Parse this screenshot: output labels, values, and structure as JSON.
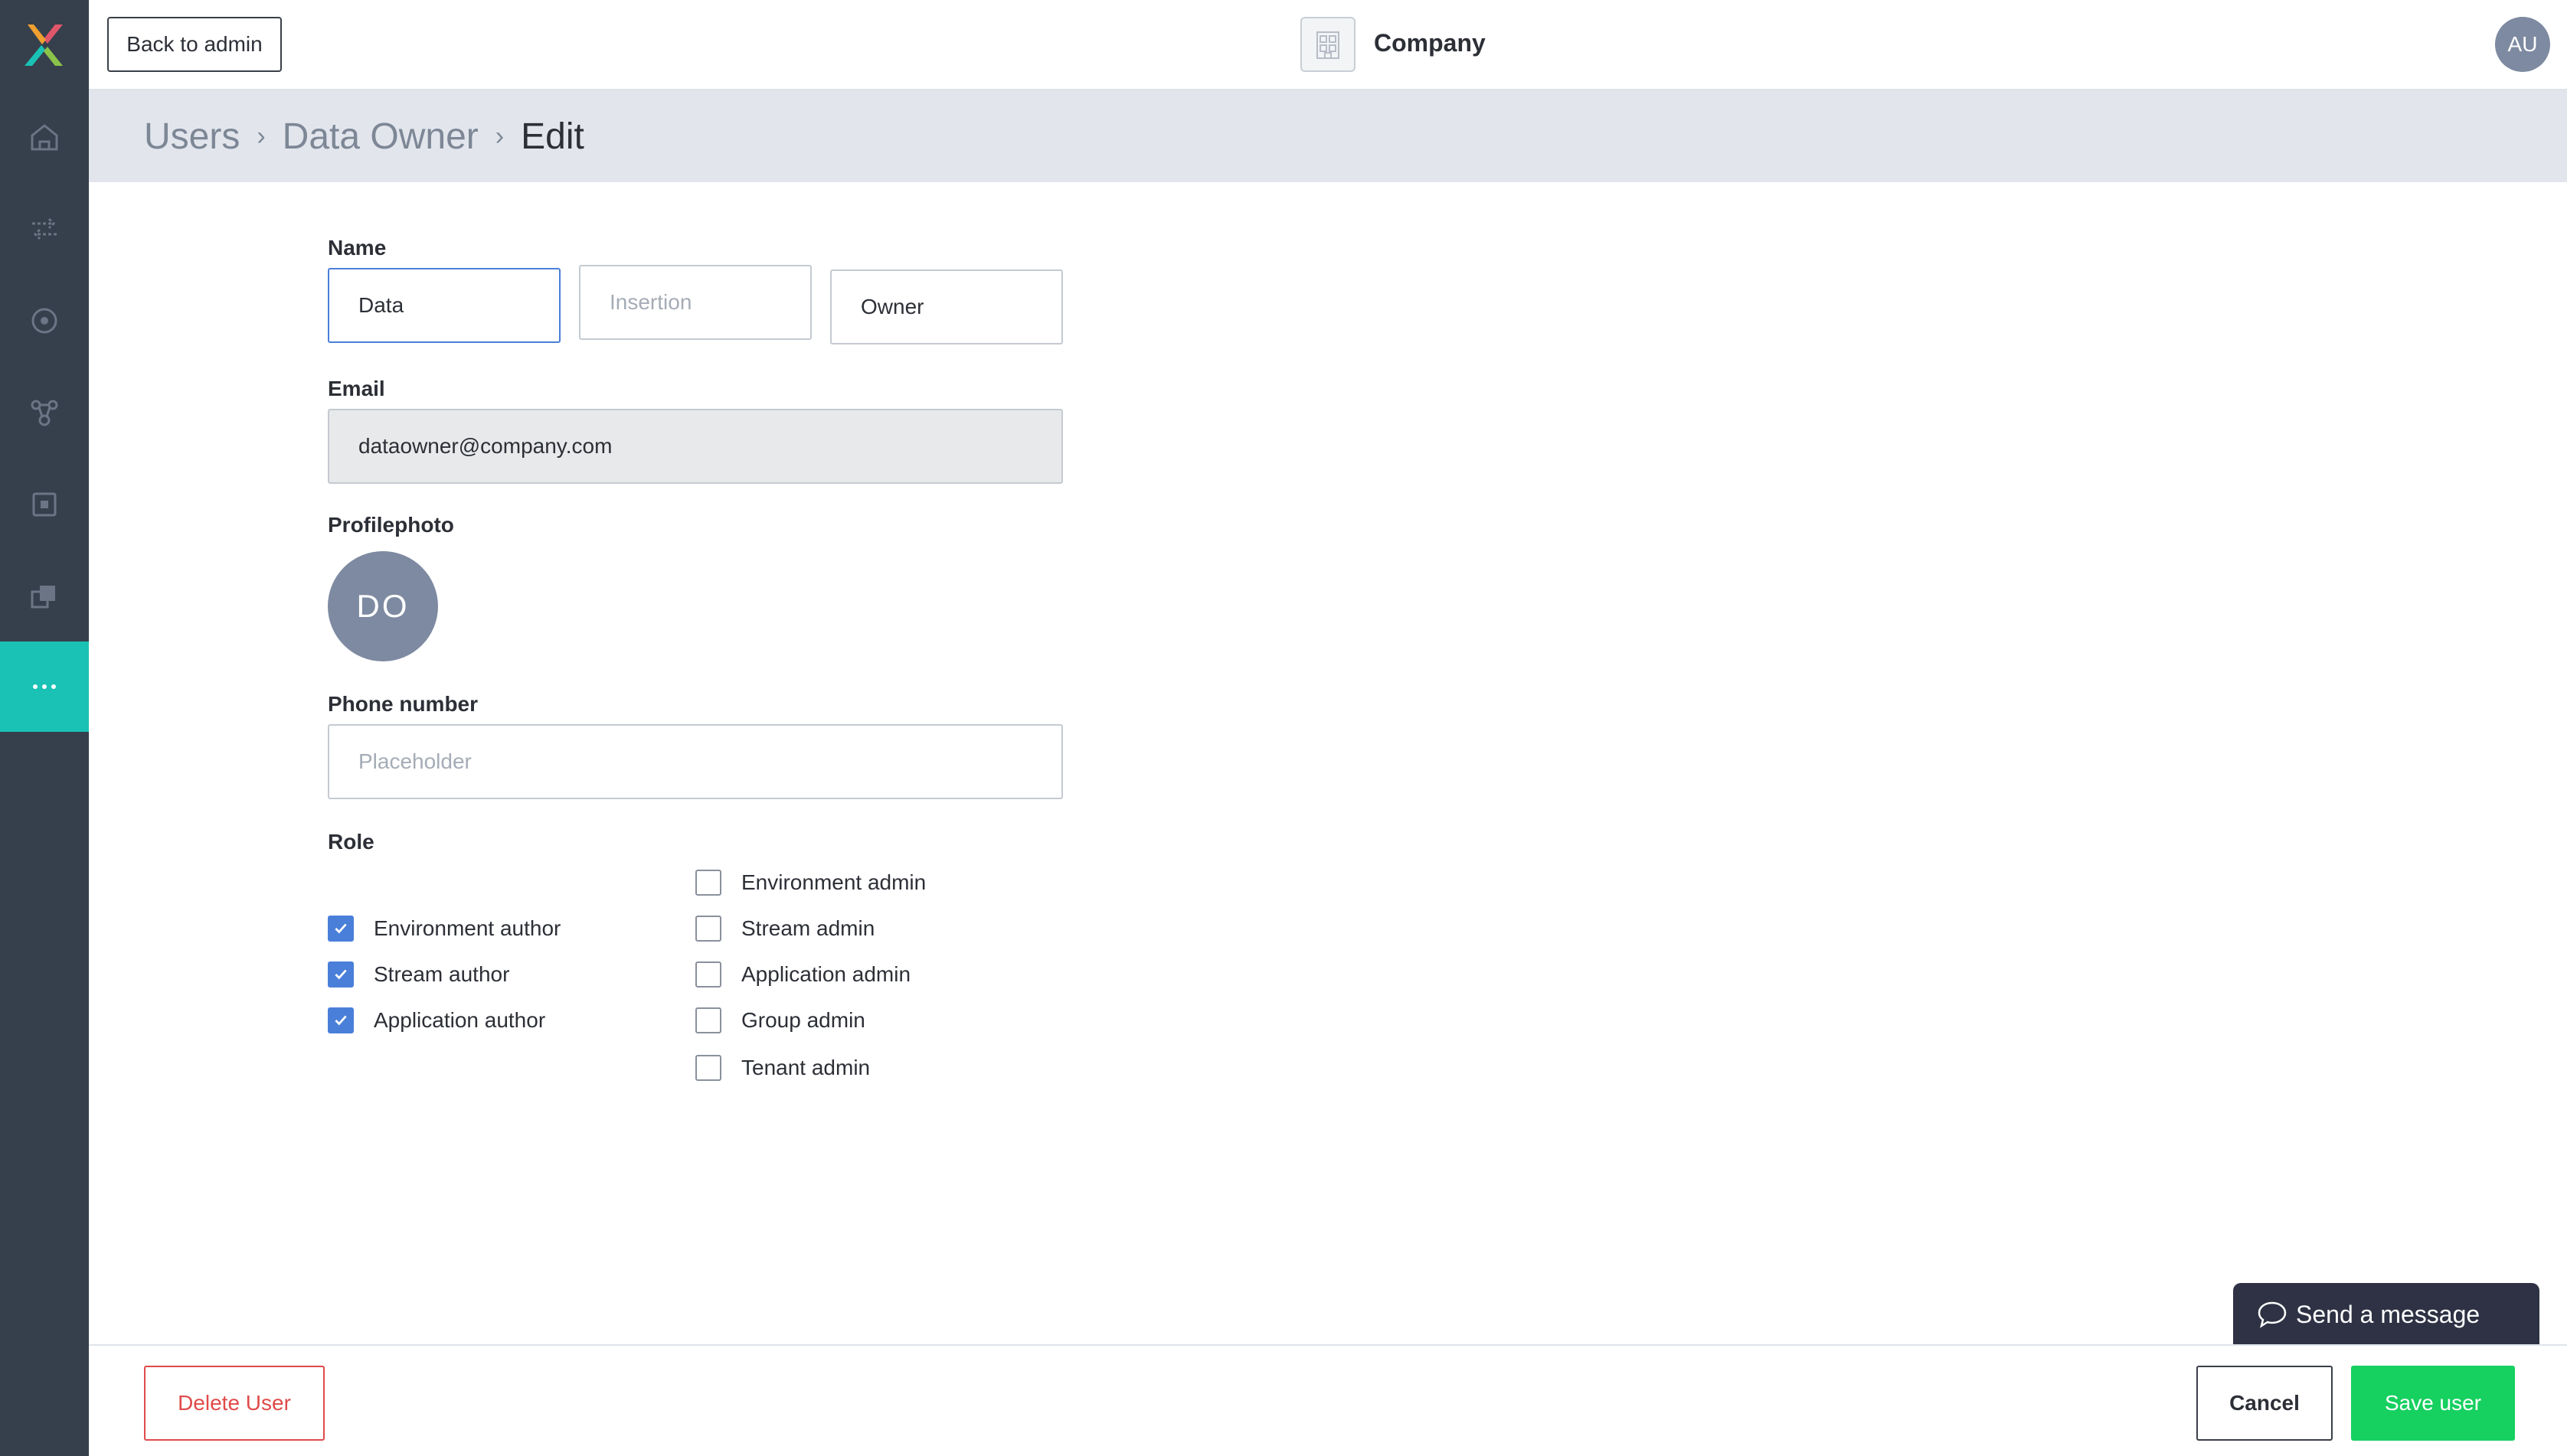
{
  "header": {
    "back_label": "Back to admin",
    "company_name": "Company",
    "user_initials": "AU"
  },
  "breadcrumb": {
    "items": [
      "Users",
      "Data Owner",
      "Edit"
    ]
  },
  "form": {
    "name_label": "Name",
    "first_name_value": "Data",
    "insertion_placeholder": "Insertion",
    "last_name_value": "Owner",
    "email_label": "Email",
    "email_value": "dataowner@company.com",
    "photo_label": "Profilephoto",
    "photo_initials": "DO",
    "phone_label": "Phone number",
    "phone_placeholder": "Placeholder",
    "role_label": "Role",
    "roles_left": [
      {
        "label": "Environment author",
        "checked": true
      },
      {
        "label": "Stream author",
        "checked": true
      },
      {
        "label": "Application author",
        "checked": true
      }
    ],
    "roles_right": [
      {
        "label": "Environment admin",
        "checked": false
      },
      {
        "label": "Stream admin",
        "checked": false
      },
      {
        "label": "Application admin",
        "checked": false
      },
      {
        "label": "Group admin",
        "checked": false
      },
      {
        "label": "Tenant admin",
        "checked": false
      }
    ]
  },
  "footer": {
    "delete_label": "Delete User",
    "cancel_label": "Cancel",
    "save_label": "Save user"
  },
  "chat": {
    "label": "Send a message"
  },
  "colors": {
    "sidebar": "#363f4c",
    "accent": "#19c2b4",
    "primary_blue": "#4a7fd9",
    "save_green": "#16d060",
    "danger_red": "#e04a4a"
  },
  "sidebar_icons": [
    "home-icon",
    "transfer-icon",
    "target-icon",
    "network-icon",
    "square-icon",
    "layers-icon",
    "more-icon"
  ]
}
